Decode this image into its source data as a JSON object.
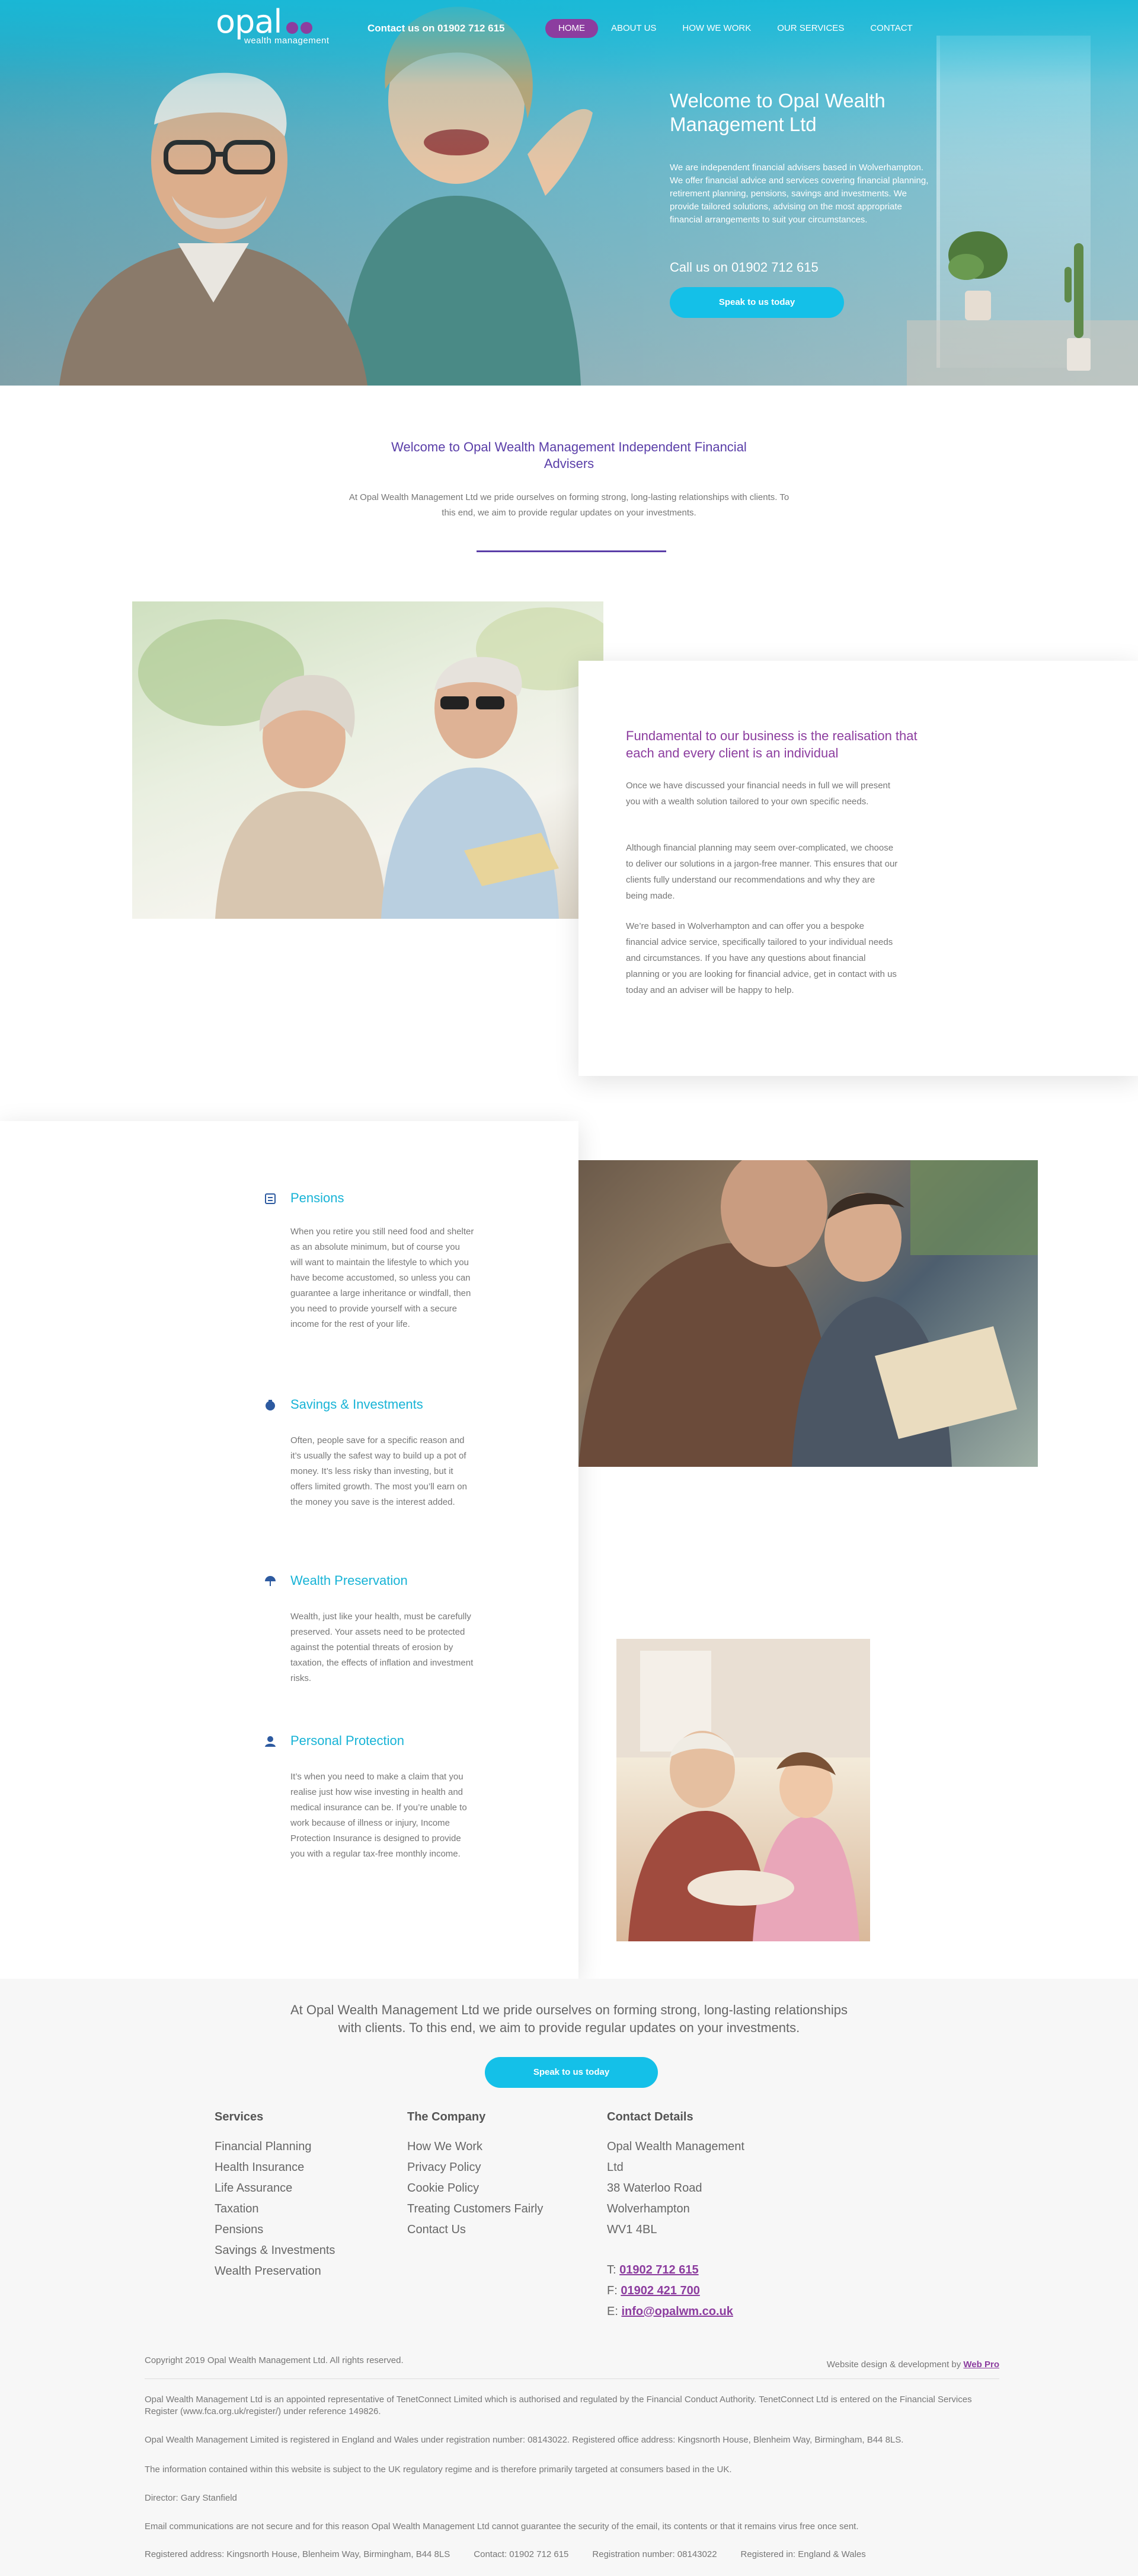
{
  "header": {
    "logo_word": "opal",
    "logo_sub": "wealth management",
    "contact": "Contact us on 01902 712 615",
    "nav": [
      {
        "label": "HOME",
        "active": true
      },
      {
        "label": "ABOUT US"
      },
      {
        "label": "HOW WE WORK"
      },
      {
        "label": "OUR SERVICES"
      },
      {
        "label": "CONTACT"
      }
    ]
  },
  "hero": {
    "title": "Welcome to Opal Wealth Management Ltd",
    "text": "We are independent financial advisers based in Wolverhampton. We offer financial advice and services covering financial planning, retirement planning, pensions, savings and investments. We provide tailored solutions, advising on the most appropriate financial arrangements to suit your circumstances.",
    "call": "Call us on 01902 712 615",
    "button": "Speak to us today"
  },
  "intro": {
    "title": "Welcome to Opal Wealth Management Independent Financial Advisers",
    "text": "At Opal Wealth Management Ltd we pride ourselves on forming strong, long-lasting relationships with clients. To this end, we aim to provide regular updates on your investments."
  },
  "about": {
    "title": "Fundamental to our business is the realisation that each and every client is an individual",
    "p1": "Once we have discussed your financial needs in full we will present you with a wealth solution tailored to your own specific needs.",
    "p2": "Although financial planning may seem over-complicated, we choose to deliver our solutions in a jargon-free manner. This ensures that our clients fully understand our recommendations and why they are being made.",
    "p3": "We’re based in Wolverhampton and can offer you a bespoke financial advice service, specifically tailored to your individual needs and circumstances. If you have any questions about financial planning or you are looking for financial advice, get in contact with us today and an adviser will be happy to help."
  },
  "services": [
    {
      "title": "Pensions",
      "icon": "pension-icon",
      "text": "When you retire you still need food and shelter as an absolute minimum, but of course you will want to maintain the lifestyle to which you have become accustomed, so unless you can guarantee a large inheritance or windfall, then you need to provide yourself with a secure income for the rest of your life."
    },
    {
      "title": "Savings & Investments",
      "icon": "savings-icon",
      "text": "Often, people save for a specific reason and it’s usually the safest way to build up a pot of money. It’s less risky than investing, but it offers limited growth. The most you’ll earn on the money you save is the interest added."
    },
    {
      "title": "Wealth Preservation",
      "icon": "umbrella-icon",
      "text": "Wealth, just like your health, must be carefully preserved. Your assets need to be protected against the potential threats of erosion by taxation, the effects of inflation and investment risks."
    },
    {
      "title": "Personal Protection",
      "icon": "person-icon",
      "text": "It’s when you need to make a claim that you realise just how wise investing in health and medical insurance can be. If you’re unable to work because of illness or injury, Income Protection Insurance is designed to provide you with a regular tax-free monthly income."
    }
  ],
  "cta": {
    "text": "At Opal Wealth Management Ltd we pride ourselves on forming strong, long-lasting relationships with clients. To this end, we aim to provide regular updates on your investments.",
    "button": "Speak to us today"
  },
  "footer": {
    "services_head": "Services",
    "services": [
      "Financial Planning",
      "Health Insurance",
      "Life Assurance",
      "Taxation",
      "Pensions",
      "Savings & Investments",
      "Wealth Preservation"
    ],
    "company_head": "The Company",
    "company": [
      "How We Work",
      "Privacy Policy",
      "Cookie Policy",
      "Treating Customers Fairly",
      "Contact Us"
    ],
    "contact_head": "Contact Details",
    "address": [
      "Opal Wealth Management",
      "Ltd",
      "38 Waterloo Road",
      "Wolverhampton",
      "WV1 4BL"
    ],
    "phone_label": "T:",
    "phone": "01902 712 615",
    "fax_label": "F:",
    "fax": "01902 421 700",
    "email_label": "E:",
    "email": "info@opalwm.co.uk",
    "copyright": "Copyright 2019 Opal Wealth Management Ltd. All rights reserved.",
    "design_prefix": "Website design & development by",
    "design_link": "Web Pro",
    "legal": [
      "Opal Wealth Management Ltd is an appointed representative of TenetConnect Limited which is authorised and regulated by the Financial Conduct Authority. TenetConnect Ltd is entered on the Financial Services Register (www.fca.org.uk/register/) under reference 149826.",
      "Opal Wealth Management Limited is registered in England and Wales under registration number: 08143022. Registered office address: Kingsnorth House, Blenheim Way, Birmingham, B44 8LS.",
      "The information contained within this website is subject to the UK regulatory regime and is therefore primarily targeted at consumers based in the UK.",
      "Director: Gary Stanfield",
      "Email communications are not secure and for this reason Opal Wealth Management Ltd cannot guarantee the security of the email, its contents or that it remains virus free once sent."
    ],
    "bottom": [
      "Registered address: Kingsnorth House, Blenheim Way, Birmingham, B44 8LS",
      "Contact: 01902 712 615",
      "Registration number: 08143022",
      "Registered in: England & Wales"
    ]
  },
  "colors": {
    "accent_purple": "#8c3d9f",
    "accent_cyan": "#14c0e8",
    "heading_indigo": "#5a3ea8"
  }
}
